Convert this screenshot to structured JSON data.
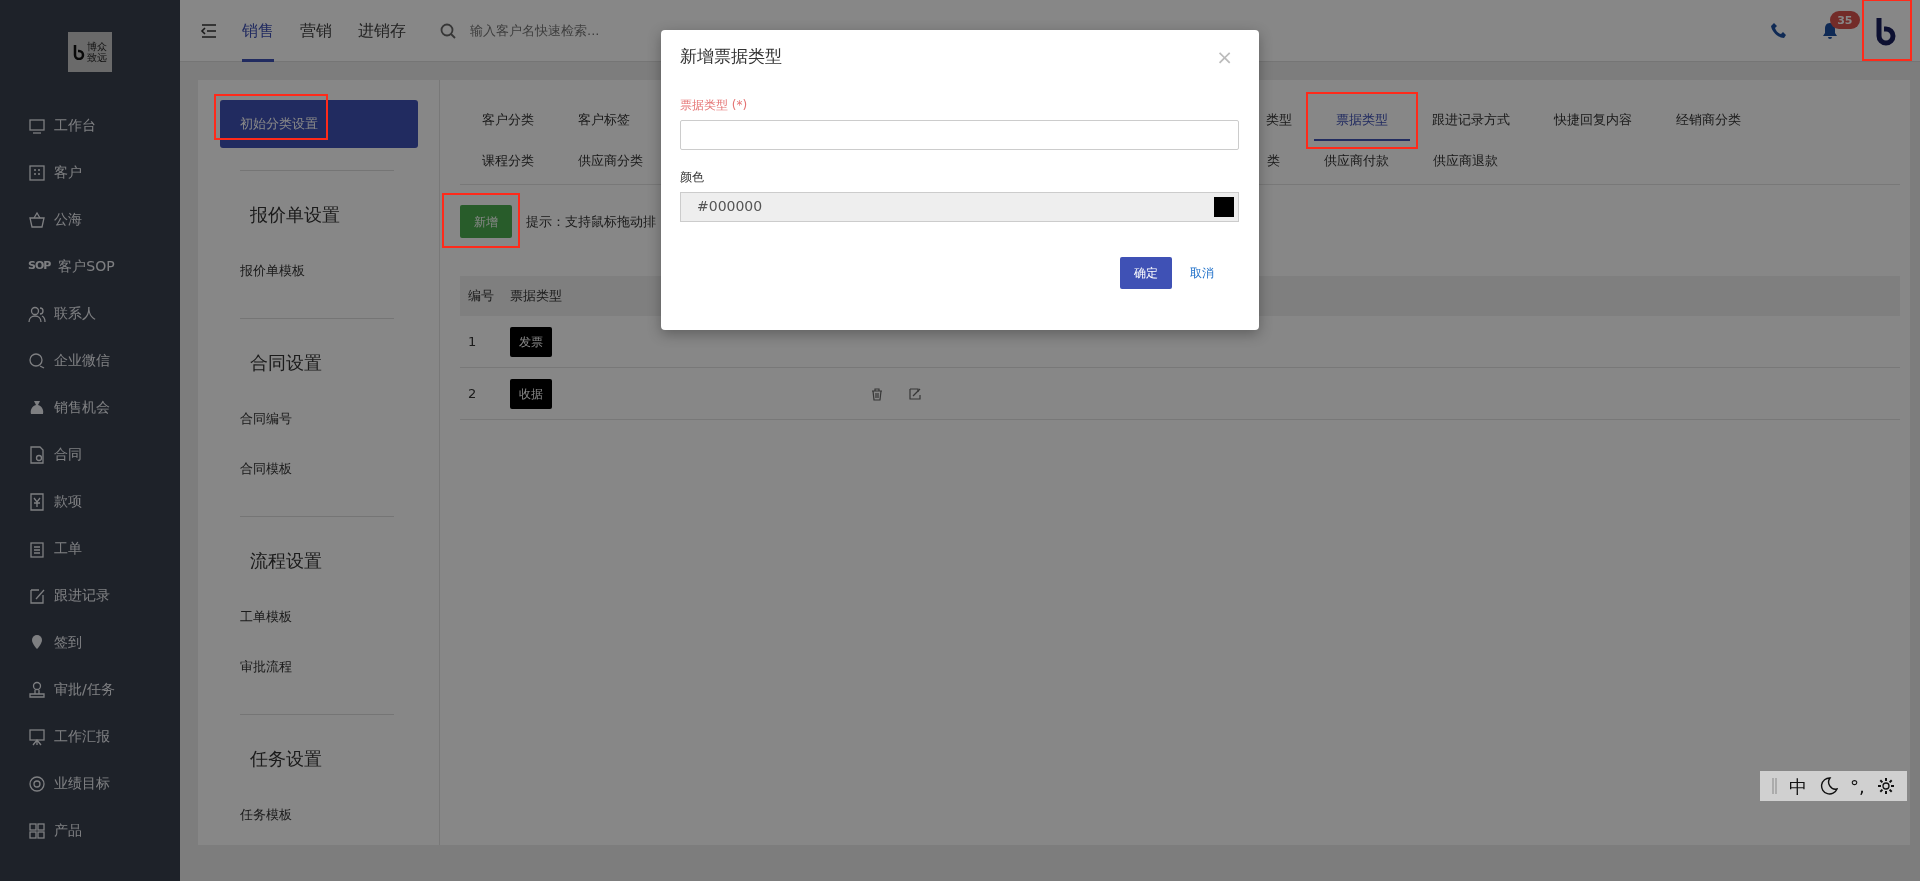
{
  "sidebar": {
    "logo": {
      "lines": [
        "博众",
        "致远"
      ]
    },
    "items": [
      {
        "label": "工作台"
      },
      {
        "label": "客户"
      },
      {
        "label": "公海"
      },
      {
        "label": "客户SOP",
        "icon_text": "SOP"
      },
      {
        "label": "联系人"
      },
      {
        "label": "企业微信"
      },
      {
        "label": "销售机会"
      },
      {
        "label": "合同"
      },
      {
        "label": "款项"
      },
      {
        "label": "工单"
      },
      {
        "label": "跟进记录"
      },
      {
        "label": "签到"
      },
      {
        "label": "审批/任务"
      },
      {
        "label": "工作汇报"
      },
      {
        "label": "业绩目标"
      },
      {
        "label": "产品"
      }
    ]
  },
  "topbar": {
    "modules": [
      {
        "label": "销售",
        "selected": true
      },
      {
        "label": "营销",
        "selected": false
      },
      {
        "label": "进销存",
        "selected": false
      }
    ],
    "search": {
      "placeholder": "输入客户名快速检索..."
    },
    "notifications": "35",
    "avatar_highlighted": true
  },
  "settings_nav": {
    "active": {
      "label": "初始分类设置",
      "selected": true,
      "highlighted": true
    },
    "groups": [
      {
        "title": "报价单设置",
        "items": [
          {
            "label": "报价单模板",
            "selected": false
          }
        ]
      },
      {
        "title": "合同设置",
        "items": [
          {
            "label": "合同编号",
            "selected": false
          },
          {
            "label": "合同模板",
            "selected": false
          }
        ]
      },
      {
        "title": "流程设置",
        "items": [
          {
            "label": "工单模板",
            "selected": false
          },
          {
            "label": "审批流程",
            "selected": false
          }
        ]
      },
      {
        "title": "任务设置",
        "items": [
          {
            "label": "任务模板",
            "selected": false
          }
        ]
      }
    ]
  },
  "category_tabs": [
    {
      "left": [
        {
          "label": "客户分类",
          "selected": false,
          "highlighted": false
        },
        {
          "label": "客户标签",
          "selected": false,
          "highlighted": false
        }
      ],
      "right": [
        {
          "label": "类型",
          "selected": false,
          "highlighted": false
        },
        {
          "label": "票据类型",
          "selected": true,
          "highlighted": true
        },
        {
          "label": "跟进记录方式",
          "selected": false,
          "highlighted": false
        },
        {
          "label": "快捷回复内容",
          "selected": false,
          "highlighted": false
        },
        {
          "label": "经销商分类",
          "selected": false,
          "highlighted": false
        }
      ]
    },
    {
      "left": [
        {
          "label": "课程分类",
          "selected": false,
          "highlighted": false
        },
        {
          "label": "供应商分类",
          "selected": false,
          "highlighted": false
        }
      ],
      "right": [
        {
          "label": "类",
          "selected": false,
          "highlighted": false
        },
        {
          "label": "供应商付款",
          "selected": false,
          "highlighted": false
        },
        {
          "label": "供应商退款",
          "selected": false,
          "highlighted": false
        }
      ]
    }
  ],
  "toolbar": {
    "add_button": {
      "label": "新增",
      "highlighted": true
    },
    "hint": "提示：支持鼠标拖动排"
  },
  "table": {
    "columns": [
      "编号",
      "票据类型"
    ],
    "rows": [
      {
        "number": "1",
        "type": "发票",
        "color": "#000000",
        "hovered": false
      },
      {
        "number": "2",
        "type": "收据",
        "color": "#000000",
        "hovered": true
      }
    ]
  },
  "modal": {
    "title": "新增票据类型",
    "close": "×",
    "fields": [
      {
        "kind": "text",
        "label": "票据类型 (*)",
        "required": true
      },
      {
        "kind": "color",
        "label": "颜色",
        "value": "#000000",
        "color": "#000000"
      }
    ],
    "buttons": [
      {
        "label": "确定",
        "kind": "primary"
      },
      {
        "label": "取消",
        "kind": "link"
      }
    ]
  },
  "ime_bar": {
    "mode": "中",
    "punct": "°,"
  }
}
